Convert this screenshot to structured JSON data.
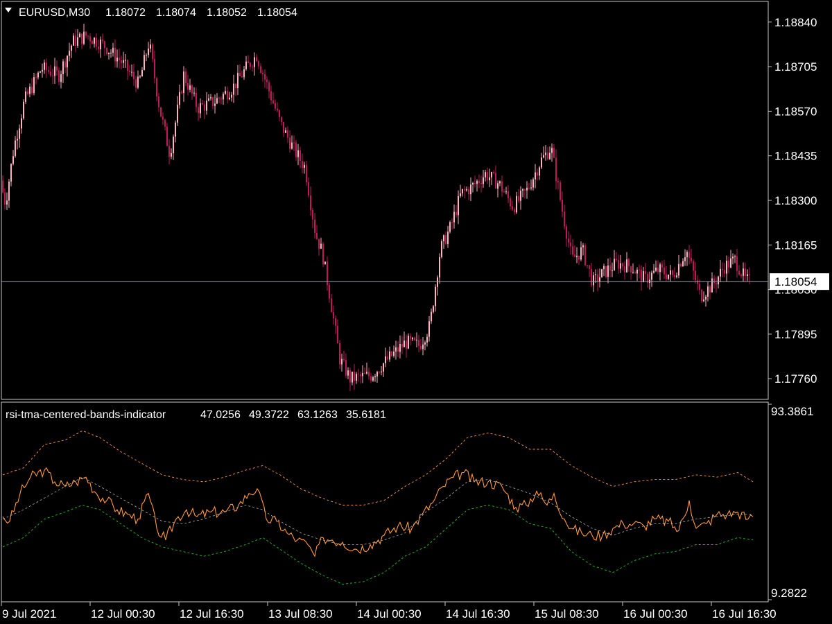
{
  "window": {
    "header": {
      "symbol": "EURUSD,M30",
      "open": "1.18072",
      "high": "1.18074",
      "low": "1.18052",
      "close": "1.18054"
    },
    "indicator_header": {
      "name": "rsi-tma-centered-bands-indicator",
      "values": [
        "47.0256",
        "49.3722",
        "63.1263",
        "35.6181"
      ]
    },
    "current_price_label": "1.18054"
  },
  "colors": {
    "background": "#000000",
    "frame": "#c8c8c8",
    "candle_bull": "#ffb3c1",
    "candle_bear": "#c2185b",
    "price_line": "#9aa3b0",
    "rsi_line": "#ff9a3c",
    "tma_line": "#b0b0b0",
    "upper_band": "#ff9a3c",
    "lower_band": "#22c022"
  },
  "chart_data": [
    {
      "type": "candlestick",
      "symbol": "EURUSD",
      "timeframe": "M30",
      "ylim": [
        1.1771,
        1.1889
      ],
      "yticks": [
        "1.18840",
        "1.18705",
        "1.18570",
        "1.18435",
        "1.18300",
        "1.18165",
        "1.18030",
        "1.17895",
        "1.17760"
      ],
      "current_price": 1.18054,
      "close_path": [
        [
          0,
          1.1836
        ],
        [
          8,
          1.1829
        ],
        [
          20,
          1.1846
        ],
        [
          35,
          1.186
        ],
        [
          60,
          1.187
        ],
        [
          85,
          1.1868
        ],
        [
          105,
          1.1878
        ],
        [
          125,
          1.188
        ],
        [
          150,
          1.1877
        ],
        [
          175,
          1.1872
        ],
        [
          200,
          1.1865
        ],
        [
          215,
          1.1878
        ],
        [
          230,
          1.1858
        ],
        [
          245,
          1.1844
        ],
        [
          265,
          1.1868
        ],
        [
          285,
          1.1858
        ],
        [
          310,
          1.186
        ],
        [
          335,
          1.1864
        ],
        [
          355,
          1.187
        ],
        [
          370,
          1.1874
        ],
        [
          385,
          1.1865
        ],
        [
          405,
          1.1853
        ],
        [
          425,
          1.1845
        ],
        [
          440,
          1.184
        ],
        [
          455,
          1.182
        ],
        [
          465,
          1.1814
        ],
        [
          475,
          1.1802
        ],
        [
          490,
          1.1782
        ],
        [
          505,
          1.1776
        ],
        [
          535,
          1.1777
        ],
        [
          560,
          1.1782
        ],
        [
          585,
          1.1787
        ],
        [
          605,
          1.1786
        ],
        [
          620,
          1.1792
        ],
        [
          635,
          1.1815
        ],
        [
          650,
          1.1822
        ],
        [
          665,
          1.1832
        ],
        [
          680,
          1.1834
        ],
        [
          700,
          1.1838
        ],
        [
          720,
          1.1835
        ],
        [
          740,
          1.1828
        ],
        [
          760,
          1.1833
        ],
        [
          780,
          1.1842
        ],
        [
          795,
          1.1846
        ],
        [
          810,
          1.1828
        ],
        [
          825,
          1.1812
        ],
        [
          840,
          1.1815
        ],
        [
          855,
          1.1805
        ],
        [
          870,
          1.1808
        ],
        [
          890,
          1.1811
        ],
        [
          910,
          1.181
        ],
        [
          930,
          1.1806
        ],
        [
          950,
          1.1809
        ],
        [
          970,
          1.1807
        ],
        [
          990,
          1.1815
        ],
        [
          1010,
          1.1801
        ],
        [
          1030,
          1.1805
        ],
        [
          1045,
          1.181
        ],
        [
          1060,
          1.1812
        ],
        [
          1075,
          1.1806
        ],
        [
          1085,
          1.1805
        ]
      ]
    },
    {
      "type": "line",
      "title": "rsi-tma-centered-bands-indicator",
      "ylim": [
        9.2822,
        93.3861
      ],
      "yticks": [
        "93.3861",
        "9.2822"
      ],
      "series": [
        {
          "role": "rsi",
          "points": [
            [
              0,
              45
            ],
            [
              10,
              43
            ],
            [
              25,
              55
            ],
            [
              40,
              62
            ],
            [
              60,
              65
            ],
            [
              75,
              60
            ],
            [
              90,
              58
            ],
            [
              105,
              60
            ],
            [
              120,
              62
            ],
            [
              135,
              55
            ],
            [
              150,
              52
            ],
            [
              165,
              48
            ],
            [
              180,
              46
            ],
            [
              195,
              44
            ],
            [
              210,
              55
            ],
            [
              222,
              40
            ],
            [
              235,
              35
            ],
            [
              250,
              44
            ],
            [
              265,
              48
            ],
            [
              280,
              45
            ],
            [
              300,
              47
            ],
            [
              320,
              47
            ],
            [
              340,
              50
            ],
            [
              355,
              55
            ],
            [
              367,
              57
            ],
            [
              380,
              44
            ],
            [
              395,
              43
            ],
            [
              410,
              38
            ],
            [
              425,
              35
            ],
            [
              440,
              33
            ],
            [
              450,
              28
            ],
            [
              462,
              36
            ],
            [
              475,
              35
            ],
            [
              490,
              34
            ],
            [
              510,
              31
            ],
            [
              530,
              33
            ],
            [
              550,
              37
            ],
            [
              570,
              41
            ],
            [
              590,
              40
            ],
            [
              605,
              46
            ],
            [
              620,
              51
            ],
            [
              635,
              58
            ],
            [
              650,
              62
            ],
            [
              665,
              64
            ],
            [
              680,
              60
            ],
            [
              700,
              60
            ],
            [
              720,
              58
            ],
            [
              740,
              49
            ],
            [
              755,
              50
            ],
            [
              770,
              56
            ],
            [
              785,
              50
            ],
            [
              795,
              55
            ],
            [
              810,
              44
            ],
            [
              820,
              40
            ],
            [
              835,
              38
            ],
            [
              850,
              37
            ],
            [
              865,
              37
            ],
            [
              880,
              40
            ],
            [
              895,
              42
            ],
            [
              910,
              42
            ],
            [
              925,
              41
            ],
            [
              940,
              44
            ],
            [
              960,
              43
            ],
            [
              975,
              39
            ],
            [
              990,
              52
            ],
            [
              1000,
              40
            ],
            [
              1015,
              42
            ],
            [
              1030,
              46
            ],
            [
              1045,
              46
            ],
            [
              1060,
              47
            ],
            [
              1075,
              44
            ],
            [
              1082,
              45
            ]
          ]
        },
        {
          "role": "tma",
          "points": [
            [
              0,
              44
            ],
            [
              30,
              48
            ],
            [
              60,
              53
            ],
            [
              90,
              58
            ],
            [
              115,
              62
            ],
            [
              140,
              58
            ],
            [
              170,
              53
            ],
            [
              200,
              48
            ],
            [
              230,
              43
            ],
            [
              260,
              42
            ],
            [
              290,
              44
            ],
            [
              320,
              47
            ],
            [
              350,
              50
            ],
            [
              375,
              48
            ],
            [
              400,
              43
            ],
            [
              430,
              38
            ],
            [
              460,
              35
            ],
            [
              490,
              33
            ],
            [
              520,
              33
            ],
            [
              550,
              35
            ],
            [
              580,
              38
            ],
            [
              610,
              47
            ],
            [
              640,
              53
            ],
            [
              670,
              60
            ],
            [
              700,
              61
            ],
            [
              730,
              58
            ],
            [
              760,
              55
            ],
            [
              790,
              51
            ],
            [
              820,
              45
            ],
            [
              850,
              40
            ],
            [
              880,
              37
            ],
            [
              910,
              40
            ],
            [
              940,
              42
            ],
            [
              970,
              42
            ],
            [
              1000,
              44
            ],
            [
              1030,
              45
            ],
            [
              1060,
              46
            ],
            [
              1082,
              46
            ]
          ]
        },
        {
          "role": "upper-band",
          "points": [
            [
              0,
              63
            ],
            [
              30,
              66
            ],
            [
              60,
              76
            ],
            [
              90,
              78
            ],
            [
              115,
              82
            ],
            [
              140,
              79
            ],
            [
              170,
              73
            ],
            [
              200,
              68
            ],
            [
              230,
              63
            ],
            [
              260,
              61
            ],
            [
              290,
              60
            ],
            [
              320,
              62
            ],
            [
              350,
              65
            ],
            [
              375,
              67
            ],
            [
              400,
              63
            ],
            [
              430,
              57
            ],
            [
              460,
              53
            ],
            [
              490,
              50
            ],
            [
              520,
              50
            ],
            [
              550,
              52
            ],
            [
              580,
              58
            ],
            [
              610,
              63
            ],
            [
              640,
              70
            ],
            [
              670,
              79
            ],
            [
              700,
              81
            ],
            [
              730,
              79
            ],
            [
              760,
              74
            ],
            [
              790,
              74
            ],
            [
              820,
              67
            ],
            [
              850,
              62
            ],
            [
              880,
              58
            ],
            [
              910,
              60
            ],
            [
              940,
              61
            ],
            [
              970,
              61
            ],
            [
              1000,
              63
            ],
            [
              1030,
              62
            ],
            [
              1060,
              64
            ],
            [
              1082,
              60
            ]
          ]
        },
        {
          "role": "lower-band",
          "points": [
            [
              0,
              32
            ],
            [
              30,
              36
            ],
            [
              60,
              44
            ],
            [
              90,
              47
            ],
            [
              115,
              50
            ],
            [
              140,
              48
            ],
            [
              170,
              42
            ],
            [
              200,
              36
            ],
            [
              230,
              32
            ],
            [
              260,
              30
            ],
            [
              290,
              28
            ],
            [
              320,
              30
            ],
            [
              350,
              33
            ],
            [
              375,
              36
            ],
            [
              400,
              31
            ],
            [
              430,
              25
            ],
            [
              460,
              20
            ],
            [
              490,
              16
            ],
            [
              520,
              17
            ],
            [
              550,
              21
            ],
            [
              580,
              28
            ],
            [
              610,
              32
            ],
            [
              640,
              40
            ],
            [
              670,
              48
            ],
            [
              700,
              50
            ],
            [
              730,
              48
            ],
            [
              760,
              42
            ],
            [
              790,
              40
            ],
            [
              820,
              30
            ],
            [
              850,
              24
            ],
            [
              880,
              21
            ],
            [
              910,
              26
            ],
            [
              940,
              29
            ],
            [
              970,
              30
            ],
            [
              1000,
              33
            ],
            [
              1030,
              33
            ],
            [
              1060,
              36
            ],
            [
              1082,
              35
            ]
          ]
        }
      ]
    }
  ],
  "xaxis": {
    "labels": [
      "9 Jul 2021",
      "12 Jul 00:30",
      "12 Jul 16:30",
      "13 Jul 08:30",
      "14 Jul 00:30",
      "14 Jul 16:30",
      "15 Jul 08:30",
      "16 Jul 00:30",
      "16 Jul 16:30"
    ]
  }
}
